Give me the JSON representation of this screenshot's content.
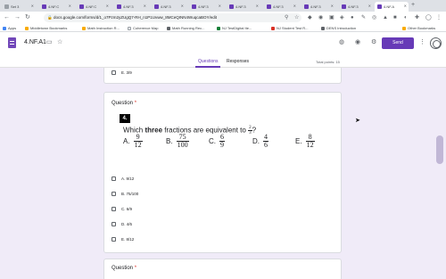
{
  "browser": {
    "tabs": [
      {
        "title": "Set 3"
      },
      {
        "title": "4.NF.C"
      },
      {
        "title": "4.NF.C"
      },
      {
        "title": "4.NF.3"
      },
      {
        "title": "4.NF.3"
      },
      {
        "title": "4.NF.3"
      },
      {
        "title": "4.NF.3"
      },
      {
        "title": "4.NF.3"
      },
      {
        "title": "4.NF.3"
      },
      {
        "title": "4.NF.3"
      },
      {
        "title": "4.NF.A"
      }
    ],
    "new_tab": "+",
    "url": "docs.google.com/forms/d/1_o7Pzm2yZUgQ7-RH_n1P1Uvww_8MCeQINN4WuqcaBOY/edit",
    "bookmarks": [
      {
        "label": "Apps",
        "color": "#4285f4"
      },
      {
        "label": "Middletown Bookmarks",
        "color": "#f9ab00"
      },
      {
        "label": "Math Instruction R...",
        "color": "#f9ab00"
      },
      {
        "label": "Coherence Map",
        "color": "#e8eaed"
      },
      {
        "label": "Math Running Rec...",
        "color": "#5f6368"
      },
      {
        "label": "NJ TestDigital Ite...",
        "color": "#188038"
      },
      {
        "label": "NJ Student Test R...",
        "color": "#d93025"
      },
      {
        "label": "DENS Introduction",
        "color": "#5f6368"
      },
      {
        "label": "Other Bookmarks",
        "color": "#f9ab00"
      }
    ]
  },
  "header": {
    "doc_title": "4.NF.A1",
    "send_label": "Send",
    "tabs": [
      "Questions",
      "Responses"
    ],
    "total_points": "Total points: 15"
  },
  "prev_question": {
    "option_label": "E.  3/9"
  },
  "question4": {
    "label": "Question",
    "required": "*",
    "number": "4.",
    "text_before": "Which ",
    "text_bold": "three",
    "text_after": " fractions are equivalent to ",
    "target": {
      "num": "2",
      "den": "3"
    },
    "qmark": "?",
    "choices": [
      {
        "letter": "A.",
        "num": "9",
        "den": "12"
      },
      {
        "letter": "B.",
        "num": "75",
        "den": "100"
      },
      {
        "letter": "C.",
        "num": "6",
        "den": "9"
      },
      {
        "letter": "D.",
        "num": "4",
        "den": "6"
      },
      {
        "letter": "E.",
        "num": "8",
        "den": "12"
      }
    ],
    "options": [
      "A.  9/12",
      "B.  75/100",
      "C.  6/9",
      "D.  4/6",
      "E.  8/12"
    ]
  },
  "next_question": {
    "label": "Question",
    "required": "*"
  },
  "colors": {
    "accent": "#673ab7",
    "background": "#f0ebf8",
    "required": "#d93025"
  }
}
